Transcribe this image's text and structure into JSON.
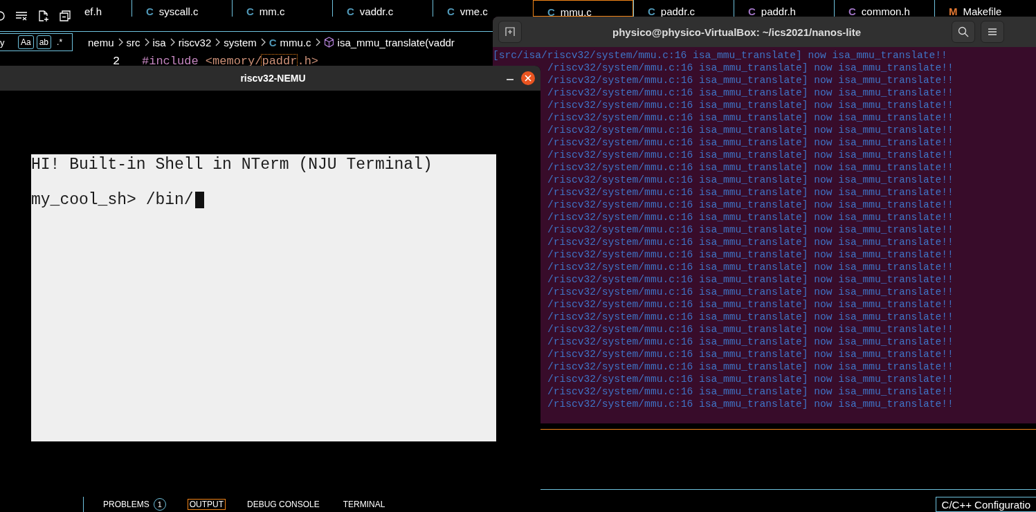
{
  "editor": {
    "tabs": [
      {
        "label": "ef.h",
        "selected": false
      },
      {
        "label": "syscall.c",
        "icon": "C",
        "kind": "c",
        "selected": false
      },
      {
        "label": "mm.c",
        "icon": "C",
        "kind": "c",
        "selected": false
      },
      {
        "label": "vaddr.c",
        "icon": "C",
        "kind": "c",
        "selected": false
      },
      {
        "label": "vme.c",
        "icon": "C",
        "kind": "c",
        "selected": false
      },
      {
        "label": "mmu.c",
        "icon": "C",
        "kind": "c",
        "selected": true
      },
      {
        "label": "paddr.c",
        "icon": "C",
        "kind": "c",
        "selected": false
      },
      {
        "label": "paddr.h",
        "icon": "C",
        "kind": "h",
        "selected": false
      },
      {
        "label": "common.h",
        "icon": "C",
        "kind": "h",
        "selected": false
      },
      {
        "label": "Makefile",
        "icon": "M",
        "kind": "make",
        "selected": false
      }
    ],
    "search": {
      "value": "y",
      "options": [
        {
          "label": "Aa",
          "selected": true
        },
        {
          "label": "ab",
          "selected": true
        },
        {
          "label": ".*",
          "selected": false
        }
      ]
    },
    "breadcrumb": [
      {
        "label": "nemu",
        "kind": "folder"
      },
      {
        "label": "src",
        "kind": "folder"
      },
      {
        "label": "isa",
        "kind": "folder"
      },
      {
        "label": "riscv32",
        "kind": "folder"
      },
      {
        "label": "system",
        "kind": "folder"
      },
      {
        "label": "mmu.c",
        "kind": "file",
        "icon": "C"
      },
      {
        "label": "isa_mmu_translate(vaddr",
        "kind": "symbol"
      }
    ],
    "code": {
      "line_number": "2",
      "tokens": [
        {
          "text": "#include",
          "kind": "keyword",
          "highlighted": false
        },
        {
          "text": " <memory/",
          "kind": "string",
          "highlighted": false
        },
        {
          "text": "paddr",
          "kind": "string",
          "highlighted": true
        },
        {
          "text": ".h>",
          "kind": "string",
          "highlighted": false
        }
      ]
    },
    "panel_tabs": [
      {
        "label": "PROBLEMS",
        "badge": "1",
        "selected": false
      },
      {
        "label": "OUTPUT",
        "selected": true
      },
      {
        "label": "DEBUG CONSOLE",
        "selected": false
      },
      {
        "label": "TERMINAL",
        "selected": false
      }
    ],
    "status": "C/C++ Configuratio"
  },
  "terminal": {
    "title": "physico@physico-VirtualBox: ~/ics2021/nanos-lite",
    "lines": [
      {
        "text": "[src/isa/riscv32/system/mmu.c:16 isa_mmu_translate] now isa_mmu_translate!!",
        "kind": "full"
      },
      {
        "text": "/riscv32/system/mmu.c:16 isa_mmu_translate] now isa_mmu_translate!!",
        "kind": "covered"
      },
      {
        "text": "/riscv32/system/mmu.c:16 isa_mmu_translate] now isa_mmu_translate!!",
        "kind": "covered"
      },
      {
        "text": "/riscv32/system/mmu.c:16 isa_mmu_translate] now isa_mmu_translate!!",
        "kind": "covered"
      },
      {
        "text": "/riscv32/system/mmu.c:16 isa_mmu_translate] now isa_mmu_translate!!",
        "kind": "covered"
      },
      {
        "text": "/riscv32/system/mmu.c:16 isa_mmu_translate] now isa_mmu_translate!!",
        "kind": "covered"
      },
      {
        "text": "/riscv32/system/mmu.c:16 isa_mmu_translate] now isa_mmu_translate!!",
        "kind": "covered"
      },
      {
        "text": "/riscv32/system/mmu.c:16 isa_mmu_translate] now isa_mmu_translate!!",
        "kind": "covered"
      },
      {
        "text": "/riscv32/system/mmu.c:16 isa_mmu_translate] now isa_mmu_translate!!",
        "kind": "covered"
      },
      {
        "text": "/riscv32/system/mmu.c:16 isa_mmu_translate] now isa_mmu_translate!!",
        "kind": "covered"
      },
      {
        "text": "/riscv32/system/mmu.c:16 isa_mmu_translate] now isa_mmu_translate!!",
        "kind": "covered"
      },
      {
        "text": "/riscv32/system/mmu.c:16 isa_mmu_translate] now isa_mmu_translate!!",
        "kind": "covered"
      },
      {
        "text": "/riscv32/system/mmu.c:16 isa_mmu_translate] now isa_mmu_translate!!",
        "kind": "covered"
      },
      {
        "text": "/riscv32/system/mmu.c:16 isa_mmu_translate] now isa_mmu_translate!!",
        "kind": "covered"
      },
      {
        "text": "/riscv32/system/mmu.c:16 isa_mmu_translate] now isa_mmu_translate!!",
        "kind": "covered"
      },
      {
        "text": "/riscv32/system/mmu.c:16 isa_mmu_translate] now isa_mmu_translate!!",
        "kind": "covered"
      },
      {
        "text": "/riscv32/system/mmu.c:16 isa_mmu_translate] now isa_mmu_translate!!",
        "kind": "covered"
      },
      {
        "text": "/riscv32/system/mmu.c:16 isa_mmu_translate] now isa_mmu_translate!!",
        "kind": "covered"
      },
      {
        "text": "/riscv32/system/mmu.c:16 isa_mmu_translate] now isa_mmu_translate!!",
        "kind": "covered"
      },
      {
        "text": "/riscv32/system/mmu.c:16 isa_mmu_translate] now isa_mmu_translate!!",
        "kind": "covered"
      },
      {
        "text": "/riscv32/system/mmu.c:16 isa_mmu_translate] now isa_mmu_translate!!",
        "kind": "covered"
      },
      {
        "text": "/riscv32/system/mmu.c:16 isa_mmu_translate] now isa_mmu_translate!!",
        "kind": "covered"
      },
      {
        "text": "/riscv32/system/mmu.c:16 isa_mmu_translate] now isa_mmu_translate!!",
        "kind": "covered"
      },
      {
        "text": "/riscv32/system/mmu.c:16 isa_mmu_translate] now isa_mmu_translate!!",
        "kind": "covered"
      },
      {
        "text": "/riscv32/system/mmu.c:16 isa_mmu_translate] now isa_mmu_translate!!",
        "kind": "covered"
      },
      {
        "text": "/riscv32/system/mmu.c:16 isa_mmu_translate] now isa_mmu_translate!!",
        "kind": "covered"
      },
      {
        "text": "/riscv32/system/mmu.c:16 isa_mmu_translate] now isa_mmu_translate!!",
        "kind": "covered"
      },
      {
        "text": "/riscv32/system/mmu.c:16 isa_mmu_translate] now isa_mmu_translate!!",
        "kind": "covered"
      },
      {
        "text": "/riscv32/system/mmu.c:16 isa_mmu_translate] now isa_mmu_translate!!",
        "kind": "covered"
      }
    ]
  },
  "nemu": {
    "title": "riscv32-NEMU",
    "screen_lines": [
      "HI! Built-in Shell in NTerm (NJU Terminal)",
      "my_cool_sh> /bin/"
    ]
  }
}
